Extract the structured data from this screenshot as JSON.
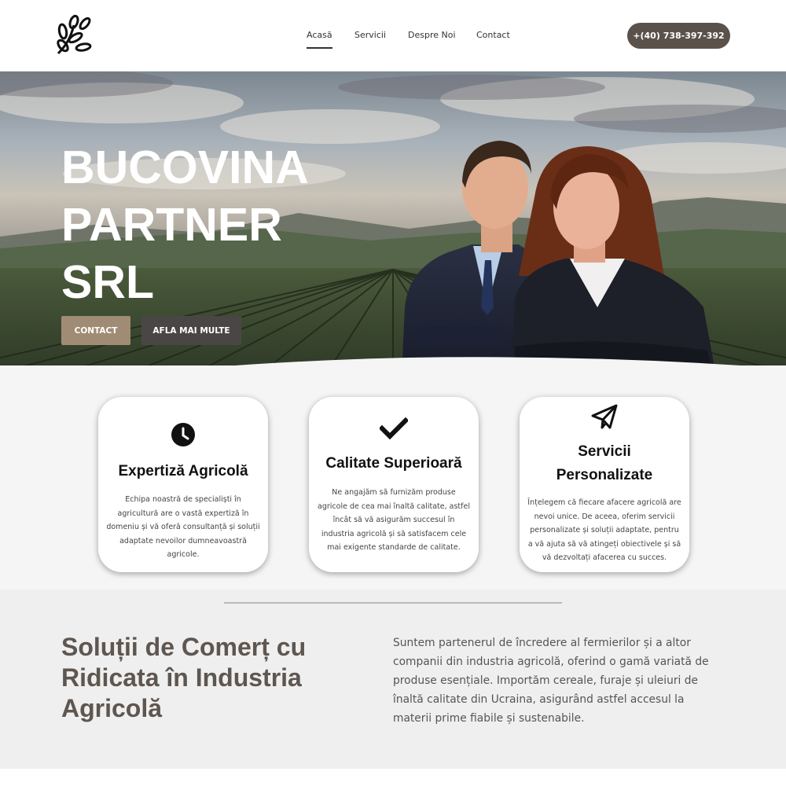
{
  "header": {
    "nav": [
      {
        "label": "Acasă",
        "active": true
      },
      {
        "label": "Servicii",
        "active": false
      },
      {
        "label": "Despre Noi",
        "active": false
      },
      {
        "label": "Contact",
        "active": false
      }
    ],
    "phone": "+(40) 738-397-392"
  },
  "hero": {
    "title_line1": "BUCOVINA",
    "title_line2": "PARTNER",
    "title_line3": "SRL",
    "contact_label": "CONTACT",
    "more_label": "AFLA MAI MULTE"
  },
  "features": [
    {
      "icon": "clock-icon",
      "title": "Expertiză Agricolă",
      "text": "Echipa noastră de specialiști în agricultură are o vastă expertiză în domeniu și vă oferă consultanță și soluții adaptate nevoilor dumneavoastră agricole."
    },
    {
      "icon": "checkmark-icon",
      "title": "Calitate Superioară",
      "text": "Ne angajăm să furnizăm produse agricole de cea mai înaltă calitate, astfel încât să vă asigurăm succesul în industria agricolă și să satisfacem cele mai exigente standarde de calitate."
    },
    {
      "icon": "paper-plane-icon",
      "title": "Servicii Personalizate",
      "text": "Înțelegem că fiecare afacere agricolă are nevoi unice. De aceea, oferim servicii personalizate și soluții adaptate, pentru a vă ajuta să vă atingeți obiectivele și să vă dezvoltați afacerea cu succes."
    }
  ],
  "about": {
    "title": "Soluții de Comerț cu Ridicata în Industria Agricolă",
    "text": "Suntem partenerul de încredere al fermierilor și a altor companii din industria agricolă, oferind o gamă variată de produse esențiale. Importăm cereale, furaje și uleiuri de înaltă calitate din Ucraina, asigurând astfel accesul la materii prime fiabile și sustenabile."
  },
  "colors": {
    "accent_dark": "#5b514b",
    "accent_tan": "#a08c74",
    "title_brown": "#5f5650"
  }
}
